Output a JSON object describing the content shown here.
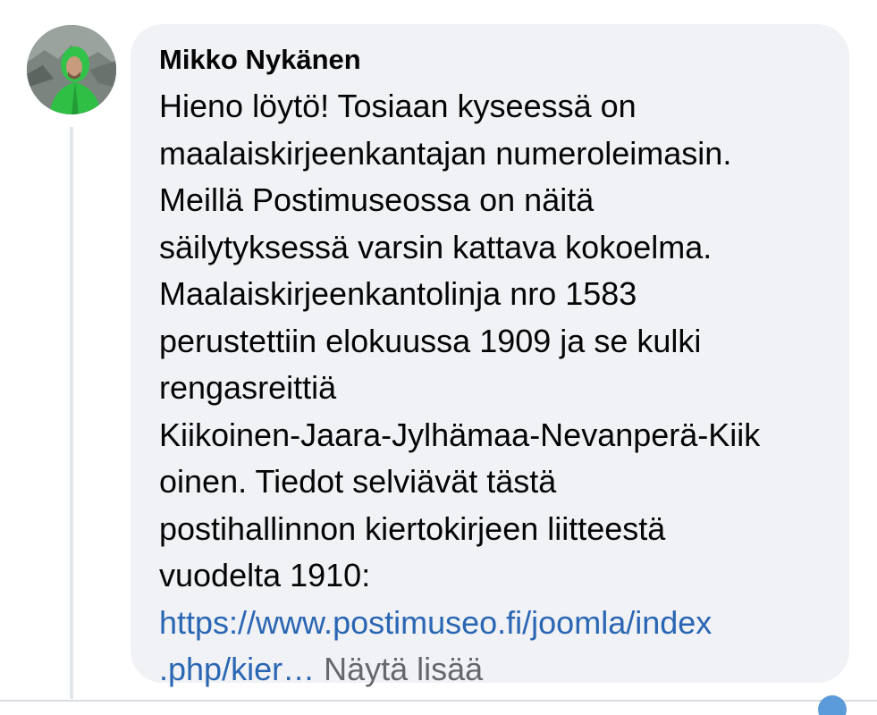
{
  "comment": {
    "author": "Mikko Nykänen",
    "lines": [
      "Hieno löytö! Tosiaan kyseessä on",
      "maalaiskirjeenkantajan numeroleimasin.",
      "Meillä Postimuseossa on näitä",
      "säilytyksessä varsin kattava kokoelma.",
      "Maalaiskirjeenkantolinja nro 1583",
      "perustettiin elokuussa 1909 ja se kulki",
      "rengasreittiä",
      "Kiikoinen-Jaara-Jylhämaa-Nevanperä-Kiik",
      "oinen. Tiedot selviävät tästä",
      "postihallinnon kiertokirjeen liitteestä",
      "vuodelta 1910:"
    ],
    "link_line_1": "https://www.postimuseo.fi/joomla/index",
    "link_line_2": ".php/kier…",
    "see_more": "Näytä lisää"
  },
  "colors": {
    "bubble_bg": "#f0f2f5",
    "text": "#050505",
    "link": "#2a66b3",
    "muted": "#65676b"
  },
  "icons": {
    "avatar": "profile-photo"
  }
}
